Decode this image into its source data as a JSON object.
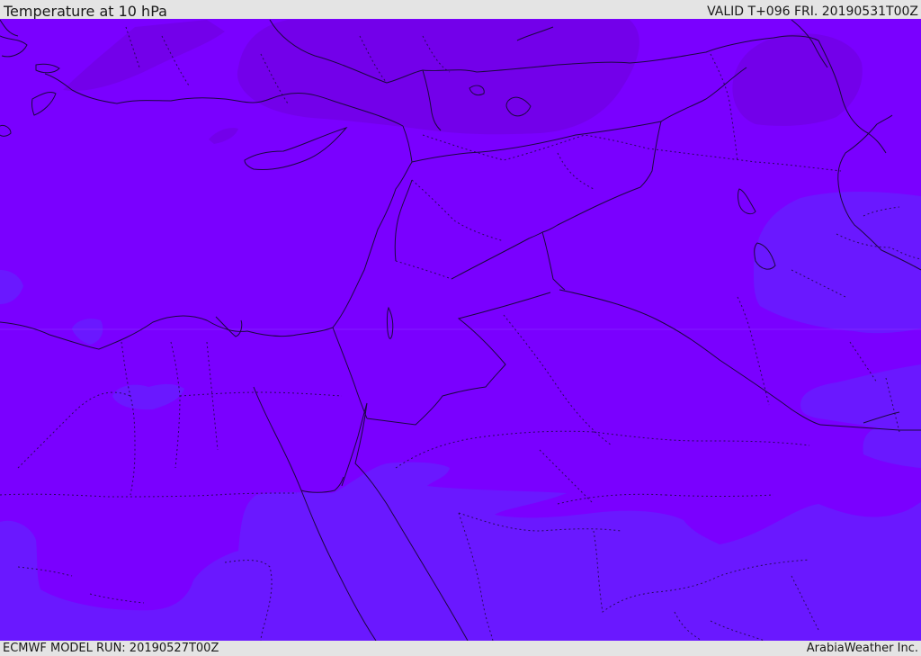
{
  "header": {
    "title": "Temperature at 10 hPa",
    "valid": "VALID T+096 FRI. 20190531T00Z"
  },
  "footer": {
    "model_run": "ECMWF MODEL RUN: 20190527T00Z",
    "brand": "ArabiaWeather Inc."
  },
  "map": {
    "colors": {
      "base_field": "#7a00ff",
      "warm_field": "#7300ea",
      "cool_field": "#6a18ff",
      "coastline": "#1c0840",
      "border": "#1c0840"
    }
  }
}
